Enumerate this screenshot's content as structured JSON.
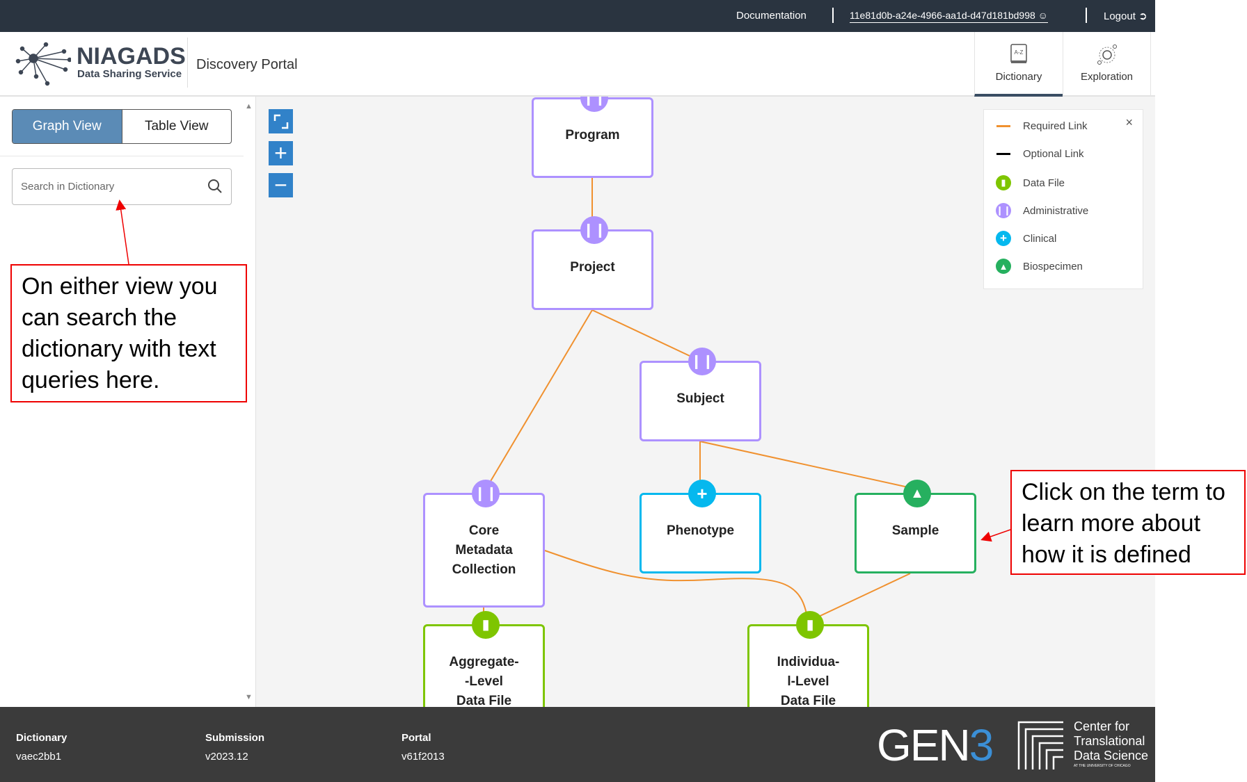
{
  "topbar": {
    "documentation": "Documentation",
    "user_id": "11e81d0b-a24e-4966-aa1d-d47d181bd998",
    "logout": "Logout"
  },
  "header": {
    "logo_title": "NIAGADS",
    "logo_subtitle": "Data Sharing Service",
    "portal_name": "Discovery Portal",
    "tabs": [
      {
        "label": "Dictionary",
        "icon": "dictionary-book-icon",
        "active": true
      },
      {
        "label": "Exploration",
        "icon": "exploration-icon",
        "active": false
      }
    ]
  },
  "sidebar": {
    "views": [
      {
        "label": "Graph View",
        "active": true
      },
      {
        "label": "Table View",
        "active": false
      }
    ],
    "search_placeholder": "Search in Dictionary"
  },
  "legend": {
    "items": [
      {
        "label": "Required Link",
        "color": "#f0912f"
      },
      {
        "label": "Optional Link",
        "color": "#000000"
      },
      {
        "label": "Data File",
        "color": "#7ec500",
        "icon": "file-icon"
      },
      {
        "label": "Administrative",
        "color": "#ad91ff",
        "icon": "book-icon"
      },
      {
        "label": "Clinical",
        "color": "#05b8ee",
        "icon": "plus-icon"
      },
      {
        "label": "Biospecimen",
        "color": "#26b05f",
        "icon": "flask-icon"
      }
    ]
  },
  "graph": {
    "nodes": [
      {
        "id": "program",
        "lines": [
          "Program"
        ],
        "category": "Administrative"
      },
      {
        "id": "project",
        "lines": [
          "Project"
        ],
        "category": "Administrative"
      },
      {
        "id": "subject",
        "lines": [
          "Subject"
        ],
        "category": "Administrative"
      },
      {
        "id": "core",
        "lines": [
          "Core",
          "Metadata",
          "Collection"
        ],
        "category": "Administrative"
      },
      {
        "id": "phenotype",
        "lines": [
          "Phenotype"
        ],
        "category": "Clinical"
      },
      {
        "id": "sample",
        "lines": [
          "Sample"
        ],
        "category": "Biospecimen"
      },
      {
        "id": "aggregate",
        "lines": [
          "Aggregate-",
          "-Level",
          "Data File"
        ],
        "category": "Data File"
      },
      {
        "id": "individual",
        "lines": [
          "Individua-",
          "l-Level",
          "Data File"
        ],
        "category": "Data File"
      }
    ]
  },
  "annotations": {
    "left": "On either view you can search the dictionary with text queries here.",
    "right": "Click on the term to learn more about how it is defined"
  },
  "footer": {
    "items": [
      {
        "label": "Dictionary",
        "value": "vaec2bb1"
      },
      {
        "label": "Submission",
        "value": "v2023.12"
      },
      {
        "label": "Portal",
        "value": "v61f2013"
      }
    ],
    "gen3_logo": "GEN3",
    "ctds_logo": "Center for Translational Data Science AT THE UNIVERSITY OF CHICAGO"
  }
}
